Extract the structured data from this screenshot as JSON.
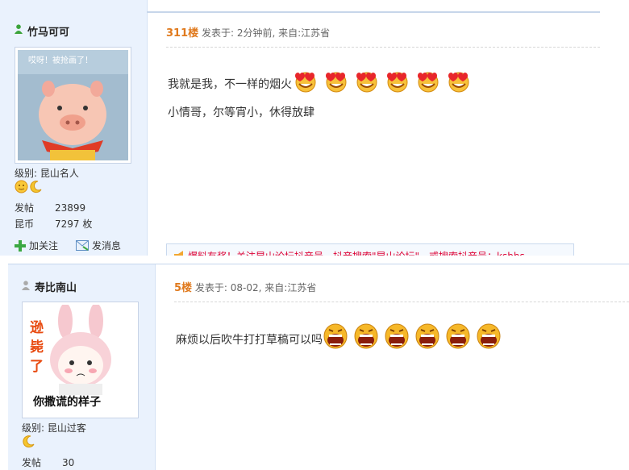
{
  "post1": {
    "username": "竹马可可",
    "avatar_caption": "哎呀！被抢画了！",
    "level_label": "级别:",
    "level_value": "昆山名人",
    "posts_label": "发帖",
    "posts_value": "23899",
    "coins_label": "昆币",
    "coins_value": "7297 枚",
    "follow_label": "加关注",
    "message_label": "发消息",
    "floor": "311楼",
    "posted_prefix": "发表于:",
    "posted_time": "2分钟前",
    "from_label": ", 来自:",
    "from_value": "江苏省",
    "lines": [
      "我就是我，不一样的烟火",
      "小情哥，尔等宵小，休得放肆"
    ],
    "emoticon": "love-heart-face-icon",
    "emoticon_count": 6,
    "ad_text": "爆料有奖！关注昆山论坛抖音号，抖音搜索\"昆山论坛\"，或搜索抖音号：ksbbs"
  },
  "post2": {
    "username": "寿比南山",
    "avatar_caption_top": "逊毙了",
    "avatar_caption": "你撒谎的样子",
    "level_label": "级别:",
    "level_value": "昆山过客",
    "posts_label": "发帖",
    "posts_value": "30",
    "floor": "5楼",
    "posted_prefix": "发表于:",
    "posted_time": "08-02",
    "from_label": ", 来自:",
    "from_value": "江苏省",
    "lines": [
      "麻烦以后吹牛打打草稿可以吗"
    ],
    "emoticon": "shouting-face-icon",
    "emoticon_count": 6
  },
  "colors": {
    "floor": "#e07a1e",
    "sidebar": "#eaf2fd",
    "border": "#c7d6ea"
  }
}
